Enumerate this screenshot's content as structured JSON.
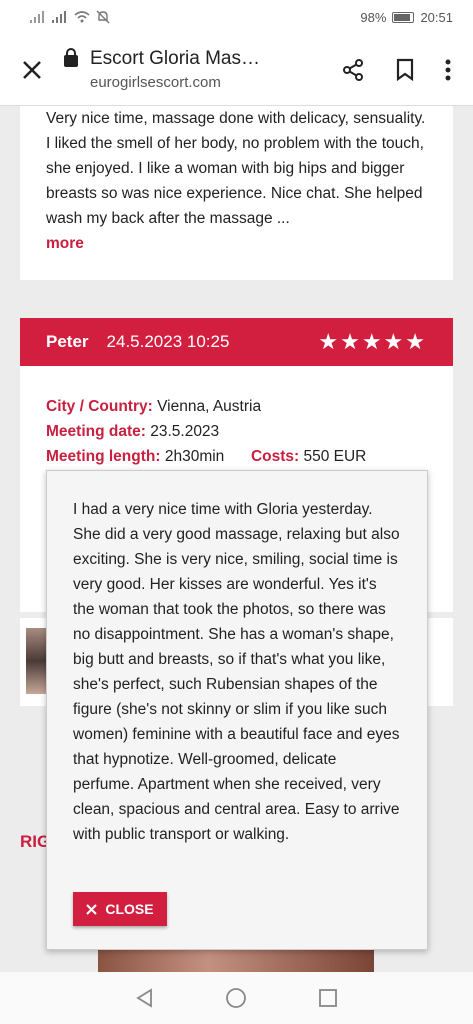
{
  "status_bar": {
    "battery": "98%",
    "time": "20:51"
  },
  "browser": {
    "title": "Escort Gloria Mas…",
    "url": "eurogirlsescort.com"
  },
  "previous_review": {
    "text": "Very nice time, massage done with delicacy, sensuality. I liked the smell of her body, no problem with the touch, she enjoyed. I like a woman with big hips and bigger breasts so was nice experience. Nice chat. She helped wash my back after the massage ...",
    "more_label": "more"
  },
  "review": {
    "name": "Peter",
    "date": "24.5.2023 10:25",
    "rating": 5,
    "stars": "★★★★★",
    "city_label": "City / Country:",
    "city_value": "Vienna, Austria",
    "meeting_date_label": "Meeting date:",
    "meeting_date_value": "23.5.2023",
    "meeting_length_label": "Meeting length:",
    "meeting_length_value": "2h30min",
    "costs_label": "Costs:",
    "costs_value": "550 EUR"
  },
  "section_heading": "RIG",
  "modal": {
    "text": "I had a very nice time with Gloria yesterday. She did a very good massage, relaxing but also exciting. She is very nice, smiling, social time is very good. Her kisses are wonderful. Yes it's the woman that took the photos, so there was no disappointment. She has a woman's shape, big butt and breasts, so if that's what you like, she's perfect, such Rubensian shapes of the figure (she's not skinny or slim if you like such women) feminine with a beautiful face and eyes that hypnotize. Well-groomed, delicate perfume. Apartment when she received, very clean, spacious and central area. Easy to arrive with public transport or walking.",
    "close_label": "CLOSE"
  },
  "colors": {
    "accent": "#d21f40",
    "label": "#c8203e"
  },
  "icons": {
    "close": "close-icon",
    "lock": "lock-icon",
    "share": "share-icon",
    "bookmark": "bookmark-icon",
    "menu": "more-vert-icon",
    "nav_back": "back-triangle-icon",
    "nav_home": "home-circle-icon",
    "nav_recents": "recents-square-icon"
  }
}
